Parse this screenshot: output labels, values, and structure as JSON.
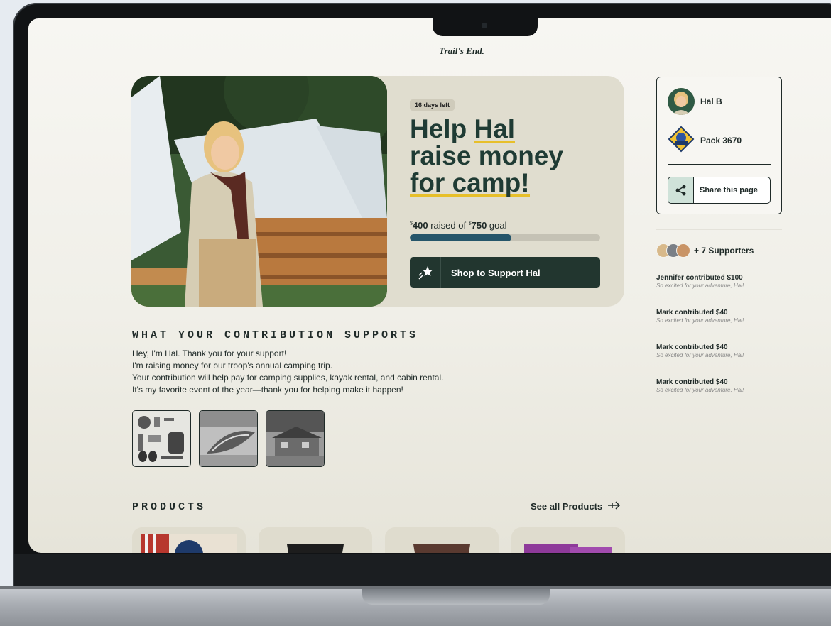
{
  "brand": {
    "logo_text": "Trail's End."
  },
  "hero": {
    "days_left": "16 days left",
    "headline_lines": [
      "Help Hal",
      "raise money",
      "for camp!"
    ],
    "raised_amount": "400",
    "raised_text": " raised of ",
    "goal_amount": "750",
    "goal_text": " goal",
    "currency": "$",
    "progress_fraction": 0.533,
    "shop_button_label": "Shop to Support Hal"
  },
  "contribution": {
    "title": "WHAT YOUR CONTRIBUTION SUPPORTS",
    "lines": [
      "Hey, I'm Hal. Thank you for your support!",
      "I'm raising money for our troop's annual camping trip.",
      "Your contribution will help pay for camping supplies, kayak rental, and cabin rental.",
      "It's my favorite event of the year—thank you for helping make it happen!"
    ]
  },
  "products": {
    "title": "PRODUCTS",
    "see_all_label": "See all Products"
  },
  "profile": {
    "name": "Hal B",
    "pack": "Pack 3670",
    "share_label": "Share this page"
  },
  "supporters": {
    "label": "+  7 Supporters",
    "feed": [
      {
        "name": "Jennifer contributed $100",
        "message": "So excited for your adventure, Hal!"
      },
      {
        "name": "Mark contributed $40",
        "message": "So excited for your adventure, Hal!"
      },
      {
        "name": "Mark contributed $40",
        "message": "So excited for your adventure, Hal!"
      },
      {
        "name": "Mark contributed $40",
        "message": "So excited for your adventure, Hal!"
      }
    ]
  },
  "colors": {
    "brand_dark": "#22362f",
    "progress": "#25556a",
    "highlight": "#e7bf2a",
    "hero_bg": "#e0ddcf"
  }
}
